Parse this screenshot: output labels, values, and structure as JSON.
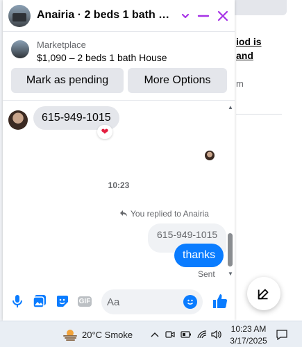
{
  "background_page": {
    "fragments": [
      "iod is",
      "and"
    ],
    "gray_fragment": "m"
  },
  "chat": {
    "title": "Anairia · 2 beds 1 bath House",
    "listing": {
      "source": "Marketplace",
      "title": "$1,090 – 2 beds 1 bath House",
      "buttons": [
        "Mark as pending",
        "More Options"
      ]
    },
    "messages": {
      "incoming": {
        "text": "615-949-1015",
        "reaction": "❤"
      },
      "timestamp": "10:23",
      "reply_note": "You replied to Anairia",
      "quoted": "615-949-1015",
      "outgoing": "thanks",
      "status": "Sent"
    },
    "composer": {
      "placeholder": "Aa",
      "icons": [
        "microphone-icon",
        "photo-icon",
        "sticker-icon",
        "gif-icon",
        "emoji-icon",
        "thumbs-up-icon"
      ],
      "gif_label": "GIF"
    }
  },
  "taskbar": {
    "weather": "20°C  Smoke",
    "time": "10:23 AM",
    "date": "3/17/2025"
  },
  "colors": {
    "accent_purple": "#a632e6",
    "messenger_blue": "#0a7cff",
    "heart_red": "#e41e3f"
  }
}
